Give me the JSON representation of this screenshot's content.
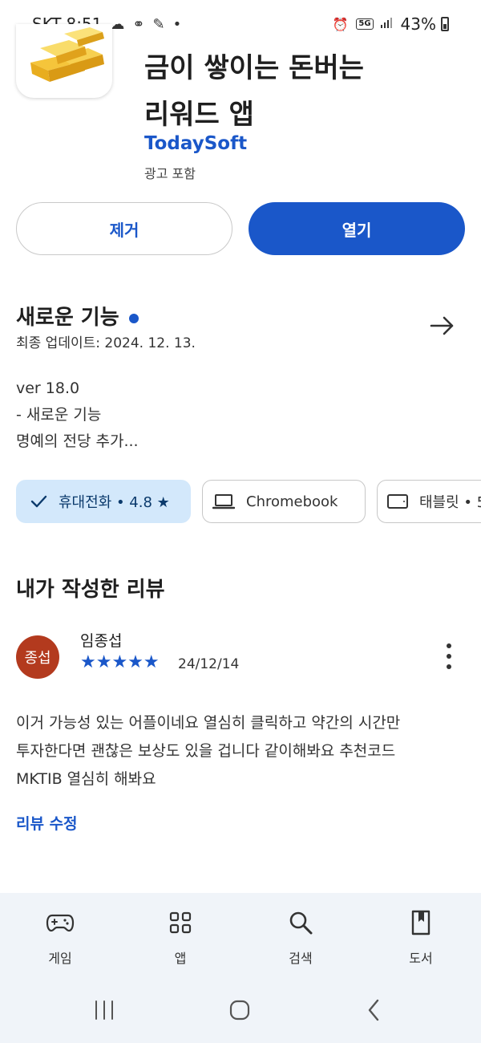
{
  "status_bar": {
    "carrier": "SKT",
    "time": "8:51",
    "network": "5G",
    "battery": "43%"
  },
  "app": {
    "title_line1": "금이 쌓이는 돈버는",
    "title_line2": "리워드 앱",
    "developer": "TodaySoft",
    "ad_label": "광고 포함",
    "remove_label": "제거",
    "open_label": "열기"
  },
  "whats_new": {
    "title": "새로운 기능",
    "updated": "최종 업데이트: 2024. 12. 13.",
    "notes": [
      "ver 18.0",
      "- 새로운 기능",
      "명예의 전당 추가..."
    ]
  },
  "device_chips": [
    {
      "label": "휴대전화 • 4.8 ★",
      "selected": true
    },
    {
      "label": "Chromebook",
      "selected": false
    },
    {
      "label": "태블릿 • 5",
      "selected": false
    }
  ],
  "my_review": {
    "title": "내가 작성한 리뷰",
    "avatar_text": "종섭",
    "reviewer": "임종섭",
    "stars": "★★★★★",
    "rating": 5,
    "date": "24/12/14",
    "lines": [
      "이거 가능성 있는 어플이네요 열심히 클릭하고 약간의 시간만",
      "투자한다면 괜찮은 보상도 있을 겁니다 같이해봐요 추천코드",
      "MKTIB 열심히 해봐요"
    ],
    "edit_label": "리뷰 수정"
  },
  "bottom_nav": [
    {
      "label": "게임",
      "icon": "gamepad-icon"
    },
    {
      "label": "앱",
      "icon": "apps-grid-icon"
    },
    {
      "label": "검색",
      "icon": "search-icon"
    },
    {
      "label": "도서",
      "icon": "book-icon"
    }
  ],
  "colors": {
    "accent": "#1a57c9",
    "chip_selected_bg": "#d3e8fb",
    "avatar_bg": "#b33a1e",
    "nav_bg": "#f0f4f9"
  }
}
